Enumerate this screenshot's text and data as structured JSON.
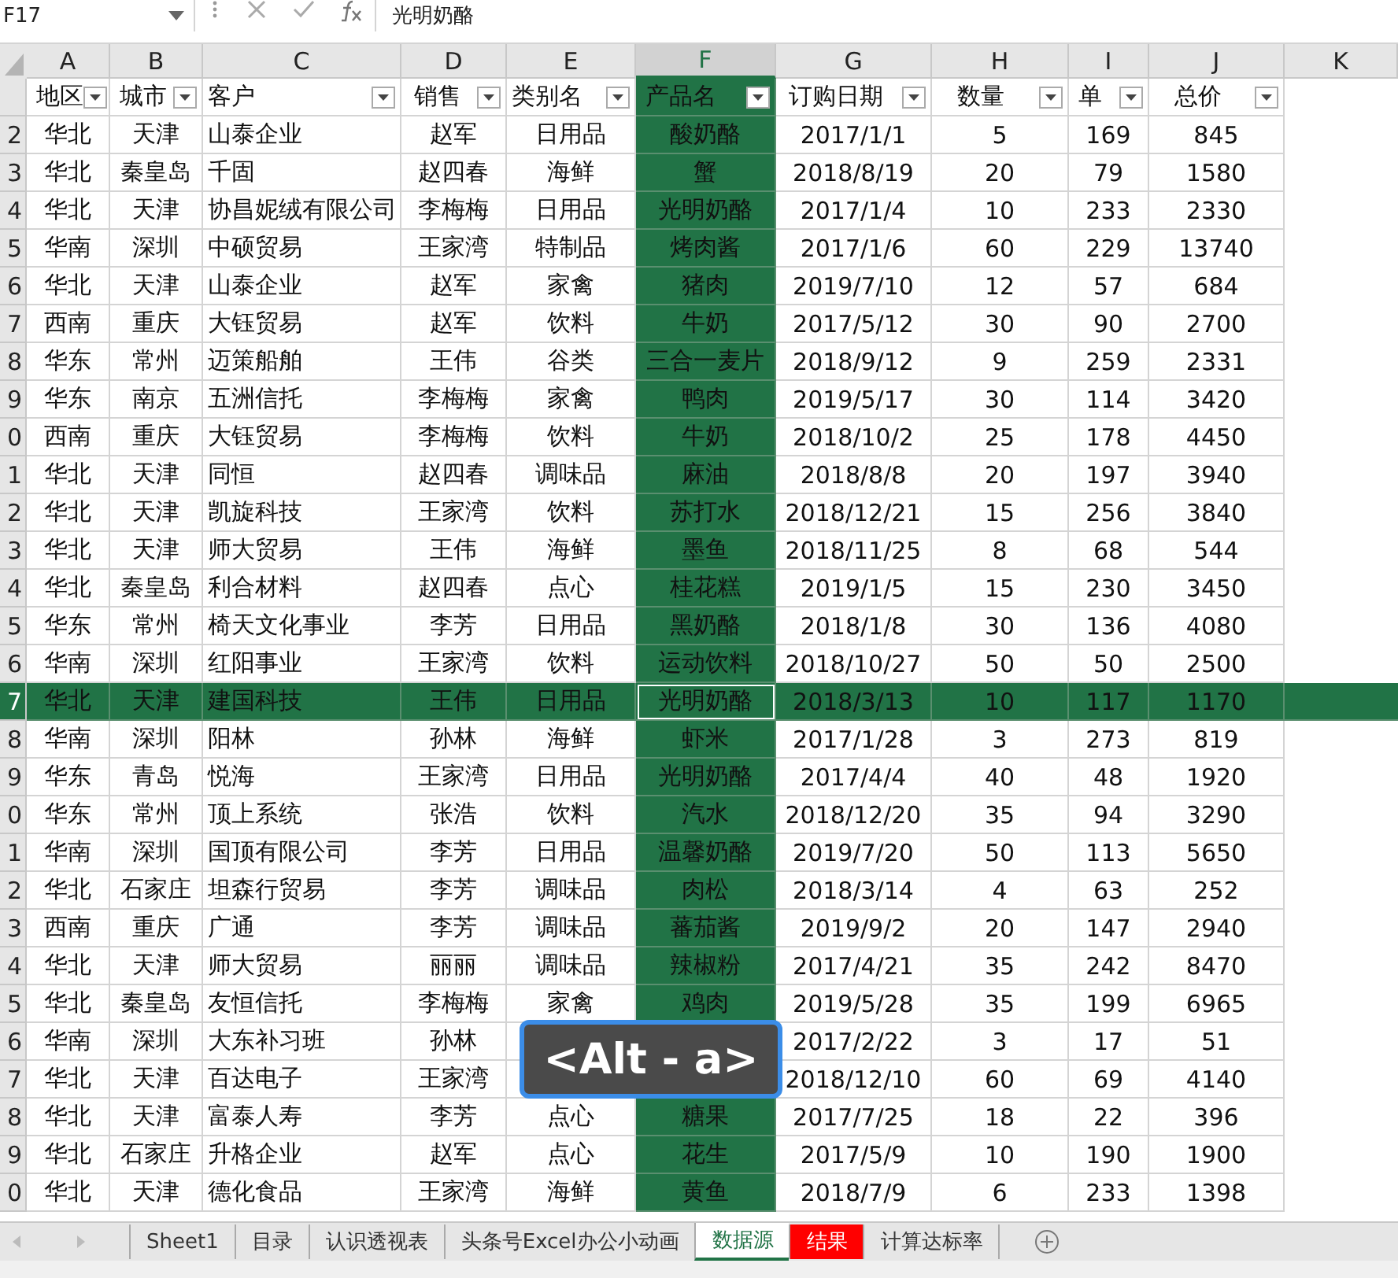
{
  "name_box": "F17",
  "formula": "光明奶酪",
  "columns": [
    {
      "letter": "A",
      "selected": false
    },
    {
      "letter": "B",
      "selected": false
    },
    {
      "letter": "C",
      "selected": false
    },
    {
      "letter": "D",
      "selected": false
    },
    {
      "letter": "E",
      "selected": false
    },
    {
      "letter": "F",
      "selected": true
    },
    {
      "letter": "G",
      "selected": false
    },
    {
      "letter": "H",
      "selected": false
    },
    {
      "letter": "I",
      "selected": false
    },
    {
      "letter": "J",
      "selected": false
    },
    {
      "letter": "K",
      "selected": false
    }
  ],
  "header": [
    "地区",
    "城市",
    "客户",
    "销售",
    "类别名",
    "产品名",
    "订购日期",
    "数量",
    "单",
    "总价"
  ],
  "rows": [
    {
      "num": "2",
      "selected": false,
      "cells": [
        "华北",
        "天津",
        "山泰企业",
        "赵军",
        "日用品",
        "酸奶酪",
        "2017/1/1",
        "5",
        "169",
        "845"
      ]
    },
    {
      "num": "3",
      "selected": false,
      "cells": [
        "华北",
        "秦皇岛",
        "千固",
        "赵四春",
        "海鲜",
        "蟹",
        "2018/8/19",
        "20",
        "79",
        "1580"
      ]
    },
    {
      "num": "4",
      "selected": false,
      "cells": [
        "华北",
        "天津",
        "协昌妮绒有限公司",
        "李梅梅",
        "日用品",
        "光明奶酪",
        "2017/1/4",
        "10",
        "233",
        "2330"
      ]
    },
    {
      "num": "5",
      "selected": false,
      "cells": [
        "华南",
        "深圳",
        "中硕贸易",
        "王家湾",
        "特制品",
        "烤肉酱",
        "2017/1/6",
        "60",
        "229",
        "13740"
      ]
    },
    {
      "num": "6",
      "selected": false,
      "cells": [
        "华北",
        "天津",
        "山泰企业",
        "赵军",
        "家禽",
        "猪肉",
        "2019/7/10",
        "12",
        "57",
        "684"
      ]
    },
    {
      "num": "7",
      "selected": false,
      "cells": [
        "西南",
        "重庆",
        "大钰贸易",
        "赵军",
        "饮料",
        "牛奶",
        "2017/5/12",
        "30",
        "90",
        "2700"
      ]
    },
    {
      "num": "8",
      "selected": false,
      "cells": [
        "华东",
        "常州",
        "迈策船舶",
        "王伟",
        "谷类",
        "三合一麦片",
        "2018/9/12",
        "9",
        "259",
        "2331"
      ]
    },
    {
      "num": "9",
      "selected": false,
      "cells": [
        "华东",
        "南京",
        "五洲信托",
        "李梅梅",
        "家禽",
        "鸭肉",
        "2019/5/17",
        "30",
        "114",
        "3420"
      ]
    },
    {
      "num": "0",
      "selected": false,
      "cells": [
        "西南",
        "重庆",
        "大钰贸易",
        "李梅梅",
        "饮料",
        "牛奶",
        "2018/10/2",
        "25",
        "178",
        "4450"
      ]
    },
    {
      "num": "1",
      "selected": false,
      "cells": [
        "华北",
        "天津",
        "同恒",
        "赵四春",
        "调味品",
        "麻油",
        "2018/8/8",
        "20",
        "197",
        "3940"
      ]
    },
    {
      "num": "2",
      "selected": false,
      "cells": [
        "华北",
        "天津",
        "凯旋科技",
        "王家湾",
        "饮料",
        "苏打水",
        "2018/12/21",
        "15",
        "256",
        "3840"
      ]
    },
    {
      "num": "3",
      "selected": false,
      "cells": [
        "华北",
        "天津",
        "师大贸易",
        "王伟",
        "海鲜",
        "墨鱼",
        "2018/11/25",
        "8",
        "68",
        "544"
      ]
    },
    {
      "num": "4",
      "selected": false,
      "cells": [
        "华北",
        "秦皇岛",
        "利合材料",
        "赵四春",
        "点心",
        "桂花糕",
        "2019/1/5",
        "15",
        "230",
        "3450"
      ]
    },
    {
      "num": "5",
      "selected": false,
      "cells": [
        "华东",
        "常州",
        "椅天文化事业",
        "李芳",
        "日用品",
        "黑奶酪",
        "2018/1/8",
        "30",
        "136",
        "4080"
      ]
    },
    {
      "num": "6",
      "selected": false,
      "cells": [
        "华南",
        "深圳",
        "红阳事业",
        "王家湾",
        "饮料",
        "运动饮料",
        "2018/10/27",
        "50",
        "50",
        "2500"
      ]
    },
    {
      "num": "7",
      "selected": true,
      "cells": [
        "华北",
        "天津",
        "建国科技",
        "王伟",
        "日用品",
        "光明奶酪",
        "2018/3/13",
        "10",
        "117",
        "1170"
      ]
    },
    {
      "num": "8",
      "selected": false,
      "cells": [
        "华南",
        "深圳",
        "阳林",
        "孙林",
        "海鲜",
        "虾米",
        "2017/1/28",
        "3",
        "273",
        "819"
      ]
    },
    {
      "num": "9",
      "selected": false,
      "cells": [
        "华东",
        "青岛",
        "悦海",
        "王家湾",
        "日用品",
        "光明奶酪",
        "2017/4/4",
        "40",
        "48",
        "1920"
      ]
    },
    {
      "num": "0",
      "selected": false,
      "cells": [
        "华东",
        "常州",
        "顶上系统",
        "张浩",
        "饮料",
        "汽水",
        "2018/12/20",
        "35",
        "94",
        "3290"
      ]
    },
    {
      "num": "1",
      "selected": false,
      "cells": [
        "华南",
        "深圳",
        "国顶有限公司",
        "李芳",
        "日用品",
        "温馨奶酪",
        "2019/7/20",
        "50",
        "113",
        "5650"
      ]
    },
    {
      "num": "2",
      "selected": false,
      "cells": [
        "华北",
        "石家庄",
        "坦森行贸易",
        "李芳",
        "调味品",
        "肉松",
        "2018/3/14",
        "4",
        "63",
        "252"
      ]
    },
    {
      "num": "3",
      "selected": false,
      "cells": [
        "西南",
        "重庆",
        "广通",
        "李芳",
        "调味品",
        "蕃茄酱",
        "2019/9/2",
        "20",
        "147",
        "2940"
      ]
    },
    {
      "num": "4",
      "selected": false,
      "cells": [
        "华北",
        "天津",
        "师大贸易",
        "丽丽",
        "调味品",
        "辣椒粉",
        "2017/4/21",
        "35",
        "242",
        "8470"
      ]
    },
    {
      "num": "5",
      "selected": false,
      "cells": [
        "华北",
        "秦皇岛",
        "友恒信托",
        "李梅梅",
        "家禽",
        "鸡肉",
        "2019/5/28",
        "35",
        "199",
        "6965"
      ]
    },
    {
      "num": "6",
      "selected": false,
      "cells": [
        "华南",
        "深圳",
        "大东补习班",
        "孙林",
        null,
        null,
        "2017/2/22",
        "3",
        "17",
        "51"
      ]
    },
    {
      "num": "7",
      "selected": false,
      "cells": [
        "华北",
        "天津",
        "百达电子",
        "王家湾",
        null,
        null,
        "2018/12/10",
        "60",
        "69",
        "4140"
      ]
    },
    {
      "num": "8",
      "selected": false,
      "cells": [
        "华北",
        "天津",
        "富泰人寿",
        "李芳",
        "点心",
        "糖果",
        "2017/7/25",
        "18",
        "22",
        "396"
      ]
    },
    {
      "num": "9",
      "selected": false,
      "cells": [
        "华北",
        "石家庄",
        "升格企业",
        "赵军",
        "点心",
        "花生",
        "2017/5/9",
        "10",
        "190",
        "1900"
      ]
    },
    {
      "num": "0",
      "selected": false,
      "cells": [
        "华北",
        "天津",
        "德化食品",
        "王家湾",
        "海鲜",
        "黄鱼",
        "2018/7/9",
        "6",
        "233",
        "1398"
      ]
    }
  ],
  "key_hint": "<Alt - a>",
  "sheet_tabs": [
    {
      "label": "Sheet1",
      "selected": false
    },
    {
      "label": "目录",
      "selected": false
    },
    {
      "label": "认识透视表",
      "selected": false
    },
    {
      "label": "头条号Excel办公小动画",
      "selected": false
    },
    {
      "label": "数据源",
      "selected": true
    },
    {
      "label": "结果",
      "selected": false,
      "color": "#ff0000"
    },
    {
      "label": "计算达标率",
      "selected": false
    }
  ]
}
